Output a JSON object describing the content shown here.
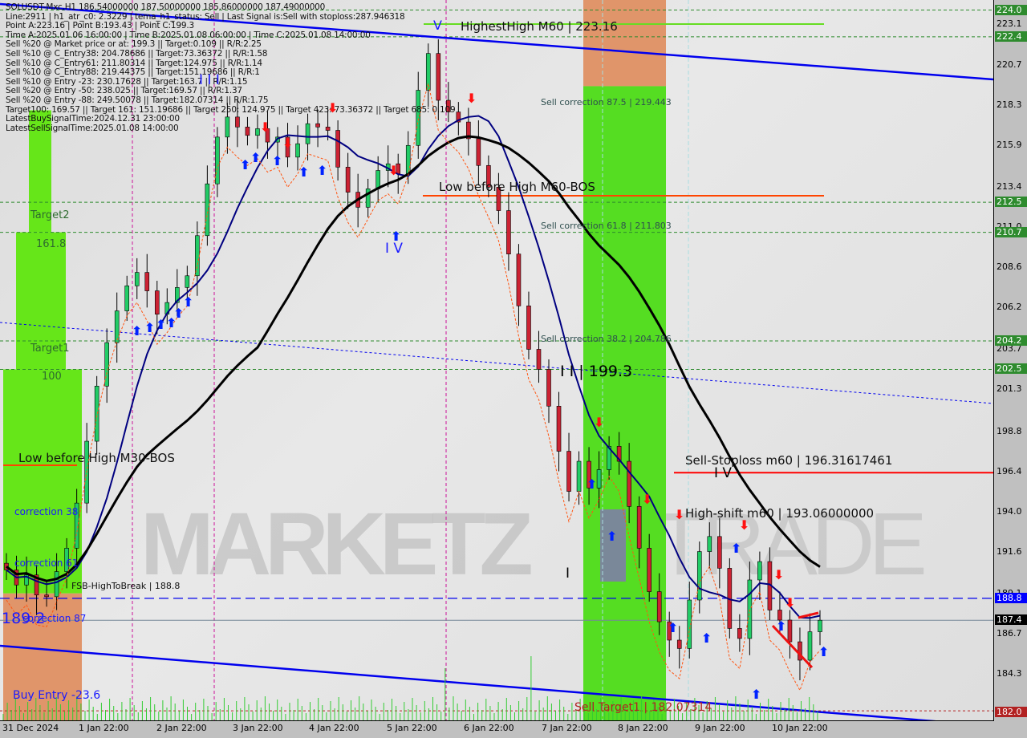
{
  "chart_data": {
    "type": "candlestick",
    "symbol": "SOLUSDT-Mxc",
    "timeframe": "H1",
    "title": "SOLUSDT-Mxc,H1  186.54000000 187.50000000 185.86000000 187.49000000",
    "ohlc_last": {
      "open": 186.54,
      "high": 187.5,
      "low": 185.86,
      "close": 187.49
    },
    "ylim": [
      181.5,
      224.6
    ],
    "y_ticks": [
      224.0,
      223.16,
      222.4,
      220.7,
      218.3,
      215.9,
      213.4,
      212.5,
      211.0,
      210.7,
      208.6,
      206.2,
      204.2,
      203.7,
      202.5,
      201.3,
      198.8,
      196.4,
      194.0,
      191.6,
      189.1,
      188.8,
      187.49,
      186.7,
      184.3,
      182.0
    ],
    "x_ticks": [
      "31 Dec 2024",
      "1 Jan 22:00",
      "2 Jan 22:00",
      "3 Jan 22:00",
      "4 Jan 22:00",
      "5 Jan 22:00",
      "6 Jan 22:00",
      "7 Jan 22:00",
      "8 Jan 22:00",
      "9 Jan 22:00",
      "10 Jan 22:00"
    ],
    "close_series": [
      190.5,
      189.6,
      190.2,
      189.0,
      188.9,
      190.4,
      191.8,
      194.5,
      198.2,
      201.5,
      204.1,
      206.0,
      207.5,
      208.3,
      207.2,
      205.8,
      206.5,
      207.4,
      208.1,
      210.5,
      213.6,
      216.4,
      217.6,
      217.0,
      216.5,
      216.9,
      216.1,
      216.4,
      215.2,
      216.0,
      217.2,
      217.0,
      216.8,
      214.6,
      213.1,
      212.2,
      213.3,
      214.4,
      214.8,
      214.2,
      215.9,
      219.2,
      221.4,
      218.6,
      217.9,
      217.3,
      216.3,
      214.7,
      213.4,
      212.0,
      209.4,
      206.3,
      203.7,
      202.5,
      200.3,
      197.6,
      195.2,
      197.0,
      195.4,
      196.5,
      197.9,
      197.0,
      194.3,
      191.8,
      189.2,
      187.4,
      186.3,
      185.8,
      188.7,
      191.6,
      192.5,
      190.6,
      187.0,
      186.4,
      189.9,
      191.0,
      188.1,
      187.5,
      186.2,
      185.1,
      186.8,
      187.49
    ],
    "levels": [
      {
        "name": "HighestHigh M60",
        "value": 223.16,
        "color": "#66dd22"
      },
      {
        "name": "Low before High M60-BOS",
        "value": 213.3,
        "color": "#ff4400"
      },
      {
        "name": "Sell-Stoploss m60",
        "value": 196.31617461,
        "color": "#ff0000"
      },
      {
        "name": "High-shift m60",
        "value": 193.06
      },
      {
        "name": "FSB-HighToBreak",
        "value": 188.8,
        "color": "#0000ff"
      },
      {
        "name": "Sell Target1",
        "value": 182.07314,
        "color": "#b22222"
      },
      {
        "name": "Target2",
        "value": 212.5
      },
      {
        "name": "161.8",
        "value": 210.7
      },
      {
        "name": "Target1",
        "value": 204.2
      },
      {
        "name": "100",
        "value": 202.5
      }
    ],
    "sell_corrections": [
      {
        "label": "Sell correction 87.5 | 219.443",
        "value": 219.443
      },
      {
        "label": "Sell correction 61.8 | 211.803",
        "value": 211.803
      },
      {
        "label": "Sell correction 38.2 | 204.786",
        "value": 204.786
      }
    ],
    "xlabel": "",
    "ylabel": ""
  },
  "info_lines": [
    "SOLUSDT-Mxc,H1  186.54000000 187.50000000 185.86000000 187.49000000",
    "Line:2911 | h1_atr_c0: 2.3229 | tema_h1_status: Sell | Last Signal is:Sell with stoploss:287.946318",
    "Point A:223.16 | Point B:193.43 | Point C:199.3",
    "Time A:2025.01.06 16:00:00 | Time B:2025.01.08 06:00:00 | Time C:2025.01.08 14:00:00",
    "Sell %20 @ Market price or at: 199.3 || Target:0.109 || R/R:2.25",
    "Sell %10 @ C_Entry38: 204.78686 || Target:73.36372 || R/R:1.58",
    "Sell %10 @ C_Entry61: 211.80314 || Target:124.975 || R/R:1.14",
    "Sell %10 @ C_Entry88: 219.44375 || Target:151.19686 || R/R:1",
    "Sell %10 @ Entry -23: 230.17628 || Target:163.7 || R/R:1.15",
    "Sell %20 @ Entry -50: 238.025 || Target:169.57 || R/R:1.37",
    "Sell %20 @ Entry -88: 249.50078 || Target:182.07314 || R/R:1.75",
    "Target100: 169.57 || Target 161: 151.19686 || Target 250: 124.975 || Target 423: 73.36372 || Target 685: 0.109",
    "LatestBuySignalTime:2024.12.31 23:00:00",
    "LatestSellSignalTime:2025.01.08 14:00:00"
  ],
  "labels": {
    "highest_high": "HighestHigh   M60 | 223.16",
    "low_before_high_m60": "Low before High   M60-BOS",
    "low_before_high_m30": "Low before High   M30-BOS",
    "sell_stoploss": "Sell-Stoploss m60 | 196.31617461",
    "high_shift": "High-shift m60 | 193.06000000",
    "fsb": "FSB-HighToBreak | 188.8",
    "sell_target1": "Sell Target1 | 182.07314",
    "buy_entry": "Buy Entry -23.6",
    "target2": "Target2",
    "t161": "161.8",
    "target1": "Target1",
    "t100": "100",
    "corr38": "correction 38",
    "corr61": "correction 61",
    "corr87": "correction 87",
    "big_price": "189.2",
    "point_c": "I I | 199.3",
    "wave_v_top": "V",
    "wave_iv": "I V",
    "wave_iv2": "I V",
    "wave_iii": "I I I",
    "wave_i": "I",
    "watermark1": "MARKETZ",
    "watermark2": "TRADE"
  },
  "price_tags": [
    {
      "text": "224.0",
      "value": 224.0,
      "bg": "#2e8b2e"
    },
    {
      "text": "222.4",
      "value": 222.4,
      "bg": "#2e8b2e"
    },
    {
      "text": "212.5",
      "value": 212.5,
      "bg": "#2e8b2e"
    },
    {
      "text": "210.7",
      "value": 210.7,
      "bg": "#2e8b2e"
    },
    {
      "text": "204.2",
      "value": 204.2,
      "bg": "#2e8b2e"
    },
    {
      "text": "202.5",
      "value": 202.5,
      "bg": "#2e8b2e"
    },
    {
      "text": "188.8",
      "value": 188.8,
      "bg": "#0000ff"
    },
    {
      "text": "187.4",
      "value": 187.49,
      "bg": "#000000"
    },
    {
      "text": "182.0",
      "value": 182.0,
      "bg": "#b22222"
    }
  ],
  "y_labels": [
    "223.1",
    "220.7",
    "218.3",
    "215.9",
    "213.4",
    "211.0",
    "208.6",
    "206.2",
    "203.7",
    "201.3",
    "198.8",
    "196.4",
    "194.0",
    "191.6",
    "189.1",
    "186.7",
    "184.3"
  ],
  "y_label_values": [
    223.16,
    220.7,
    218.3,
    215.9,
    213.4,
    211.0,
    208.6,
    206.2,
    203.7,
    201.3,
    198.8,
    196.4,
    194.0,
    191.6,
    189.1,
    186.7,
    184.3
  ]
}
